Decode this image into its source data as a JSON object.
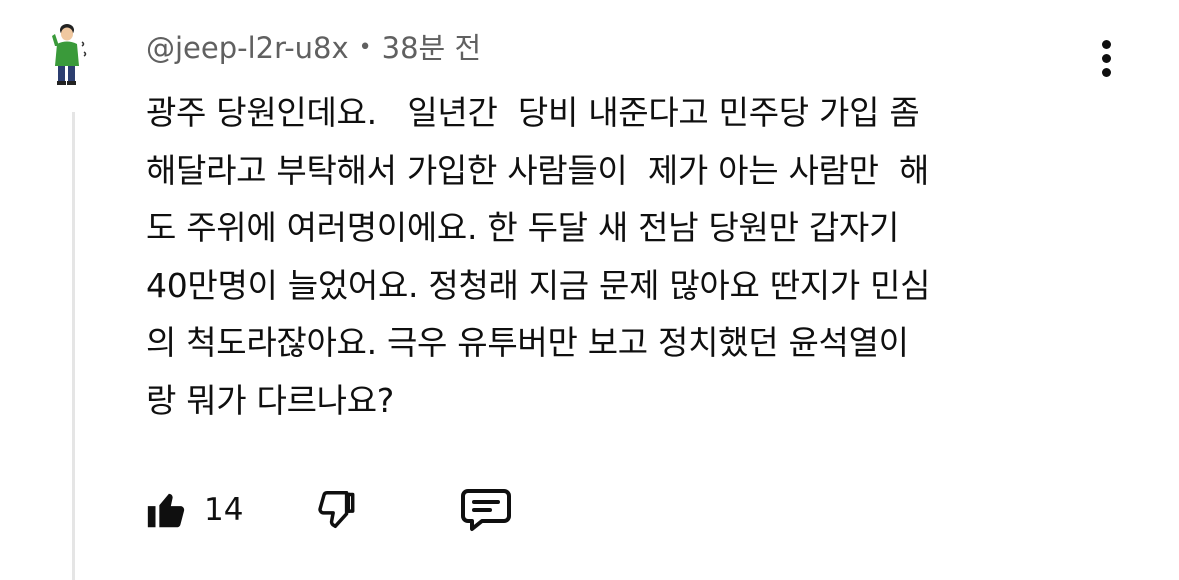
{
  "comment": {
    "author": "@jeep-l2r-u8x",
    "separator": "•",
    "time": "38분 전",
    "lines": [
      "광주 당원인데요.   일년간  당비 내준다고 민주당 가입 좀",
      "해달라고 부탁해서 가입한 사람들이  제가 아는 사람만  해",
      "도 주위에 여러명이에요. 한 두달 새 전남 당원만 갑자기",
      "40만명이 늘었어요. 정청래 지금 문제 많아요 딴지가 민심",
      "의 척도라잖아요. 극우 유투버만 보고 정치했던 윤석열이",
      "랑 뭐가 다르나요?"
    ],
    "likes": "14"
  },
  "icons": {
    "avatar": "avatar-cartoon",
    "more": "more-vert-icon",
    "like": "thumb-up-icon",
    "dislike": "thumb-down-icon",
    "reply": "comment-icon"
  },
  "colors": {
    "text": "#0f0f0f",
    "meta": "#606060",
    "thread_line": "#e5e5e5"
  }
}
